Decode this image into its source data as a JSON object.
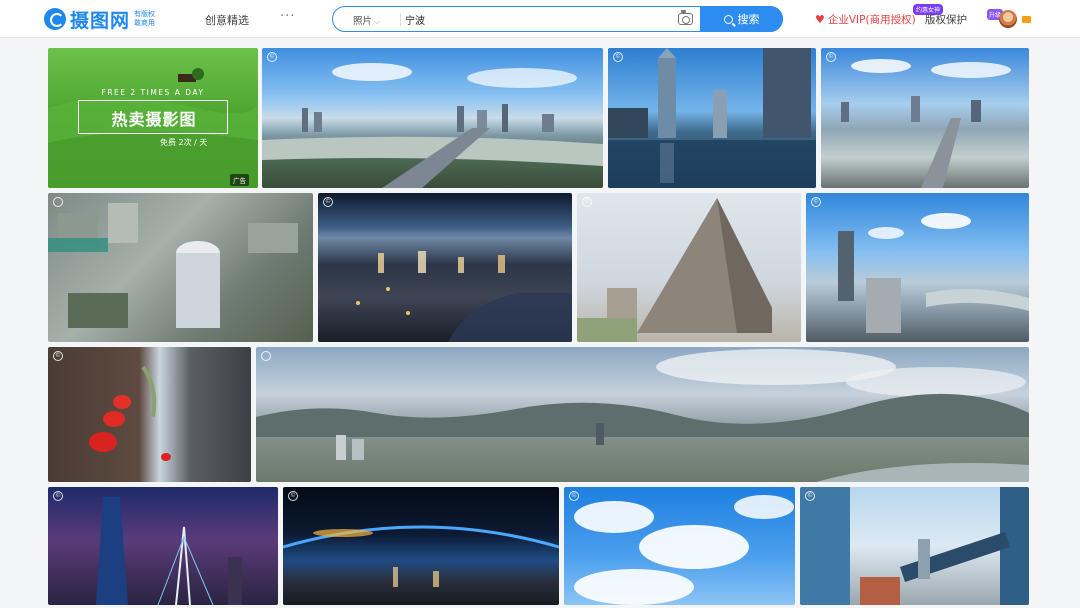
{
  "header": {
    "logo_text": "摄图网",
    "logo_sub": "有版权 敢商用",
    "nav": [
      "创意精选"
    ],
    "more": "···",
    "search": {
      "category": "照片",
      "query": "宁波",
      "button_label": "搜索"
    },
    "vip_link": "企业VIP(商用授权)",
    "vip_tag": "约惠女神",
    "copyright_link": "版权保护",
    "upgrade_badge": "升级"
  },
  "ad": {
    "line_en": "FREE 2 TIMES A DAY",
    "title": "热卖摄影图",
    "subtitle": "免费 2次 / 天",
    "badge": "广告"
  },
  "photos": [
    {
      "name": "city-river-panorama",
      "c": "©"
    },
    {
      "name": "skyscraper-reflection",
      "c": "©"
    },
    {
      "name": "riverside-skyline",
      "c": "©"
    },
    {
      "name": "aerial-tower",
      "c": ""
    },
    {
      "name": "night-city-aerial",
      "c": "©"
    },
    {
      "name": "museum-building",
      "c": "©"
    },
    {
      "name": "riverside-highrise",
      "c": "©"
    },
    {
      "name": "red-lanterns",
      "c": "©"
    },
    {
      "name": "mountain-city-panorama",
      "c": ""
    },
    {
      "name": "night-towers",
      "c": "©"
    },
    {
      "name": "earth-horizon",
      "c": "©"
    },
    {
      "name": "blue-sky-clouds",
      "c": "©"
    },
    {
      "name": "glass-building-bridge",
      "c": "©"
    }
  ],
  "colors": {
    "primary": "#2d8cf0",
    "vip_red": "#e8413f"
  }
}
